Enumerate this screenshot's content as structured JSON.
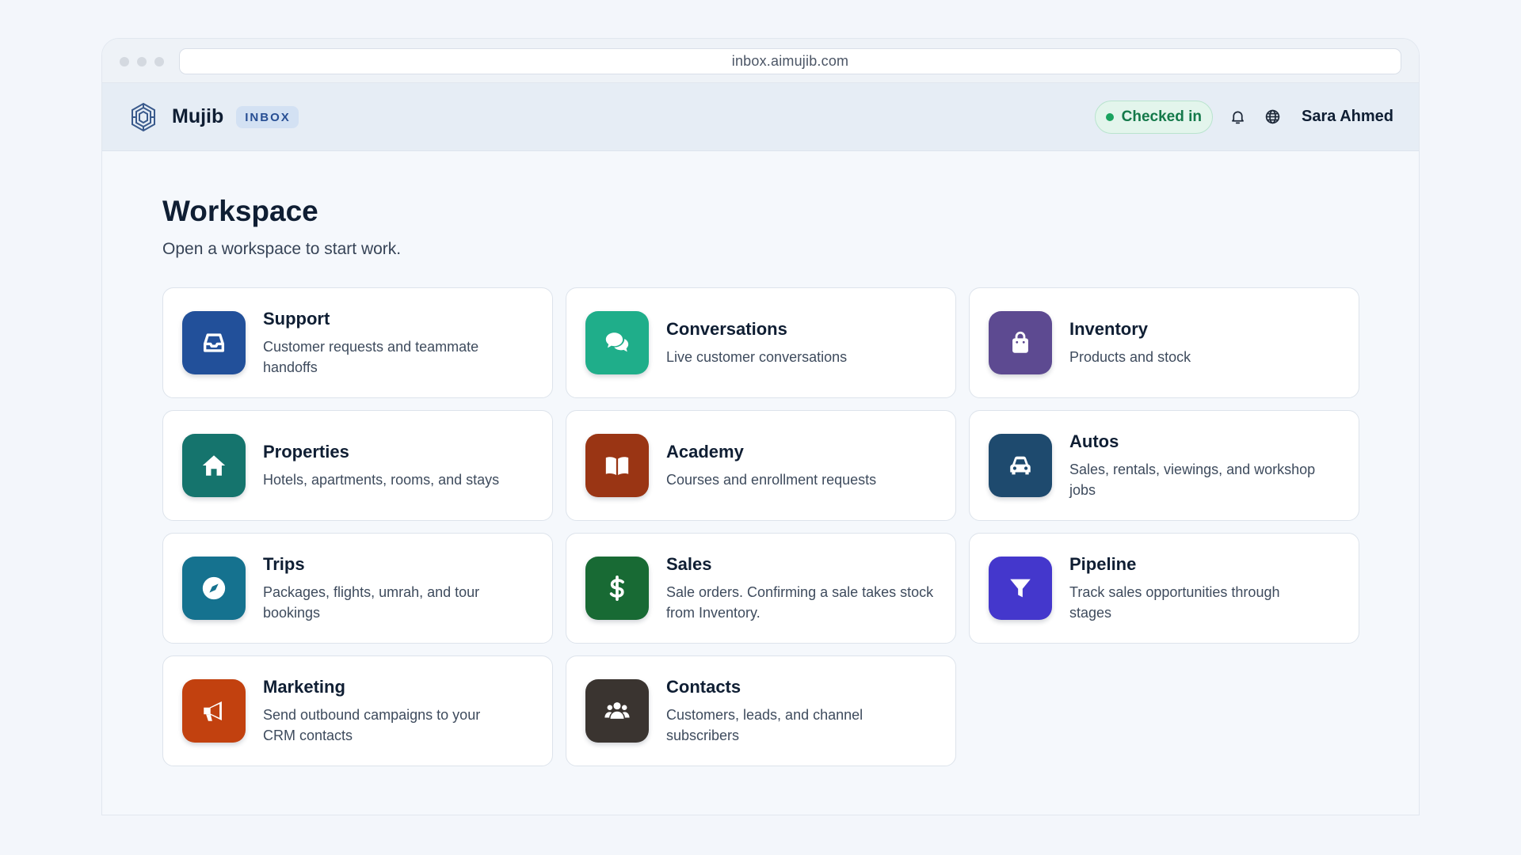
{
  "browser": {
    "url": "inbox.aimujib.com"
  },
  "header": {
    "brand_name": "Mujib",
    "brand_badge": "INBOX",
    "status": "Checked in",
    "user_name": "Sara Ahmed",
    "icons": [
      "bell-icon",
      "globe-icon"
    ]
  },
  "page": {
    "title": "Workspace",
    "subtitle": "Open a workspace to start work."
  },
  "workspaces": [
    {
      "title": "Support",
      "description": "Customer requests and teammate handoffs",
      "icon": "inbox-tray-icon",
      "color": "#22509a"
    },
    {
      "title": "Conversations",
      "description": "Live customer conversations",
      "icon": "chat-bubbles-icon",
      "color": "#1fae8a"
    },
    {
      "title": "Inventory",
      "description": "Products and stock",
      "icon": "shopping-bag-icon",
      "color": "#5d4a91"
    },
    {
      "title": "Properties",
      "description": "Hotels, apartments, rooms, and stays",
      "icon": "home-icon",
      "color": "#15746d"
    },
    {
      "title": "Academy",
      "description": "Courses and enrollment requests",
      "icon": "open-book-icon",
      "color": "#9a3514"
    },
    {
      "title": "Autos",
      "description": "Sales, rentals, viewings, and workshop jobs",
      "icon": "car-icon",
      "color": "#1e4a6e"
    },
    {
      "title": "Trips",
      "description": "Packages, flights, umrah, and tour bookings",
      "icon": "compass-icon",
      "color": "#15728f"
    },
    {
      "title": "Sales",
      "description": "Sale orders. Confirming a sale takes stock from Inventory.",
      "icon": "dollar-icon",
      "color": "#186a34"
    },
    {
      "title": "Pipeline",
      "description": "Track sales opportunities through stages",
      "icon": "funnel-icon",
      "color": "#4437cc"
    },
    {
      "title": "Marketing",
      "description": "Send outbound campaigns to your CRM contacts",
      "icon": "megaphone-icon",
      "color": "#c2410f"
    },
    {
      "title": "Contacts",
      "description": "Customers, leads, and channel subscribers",
      "icon": "users-icon",
      "color": "#3a3430"
    }
  ]
}
